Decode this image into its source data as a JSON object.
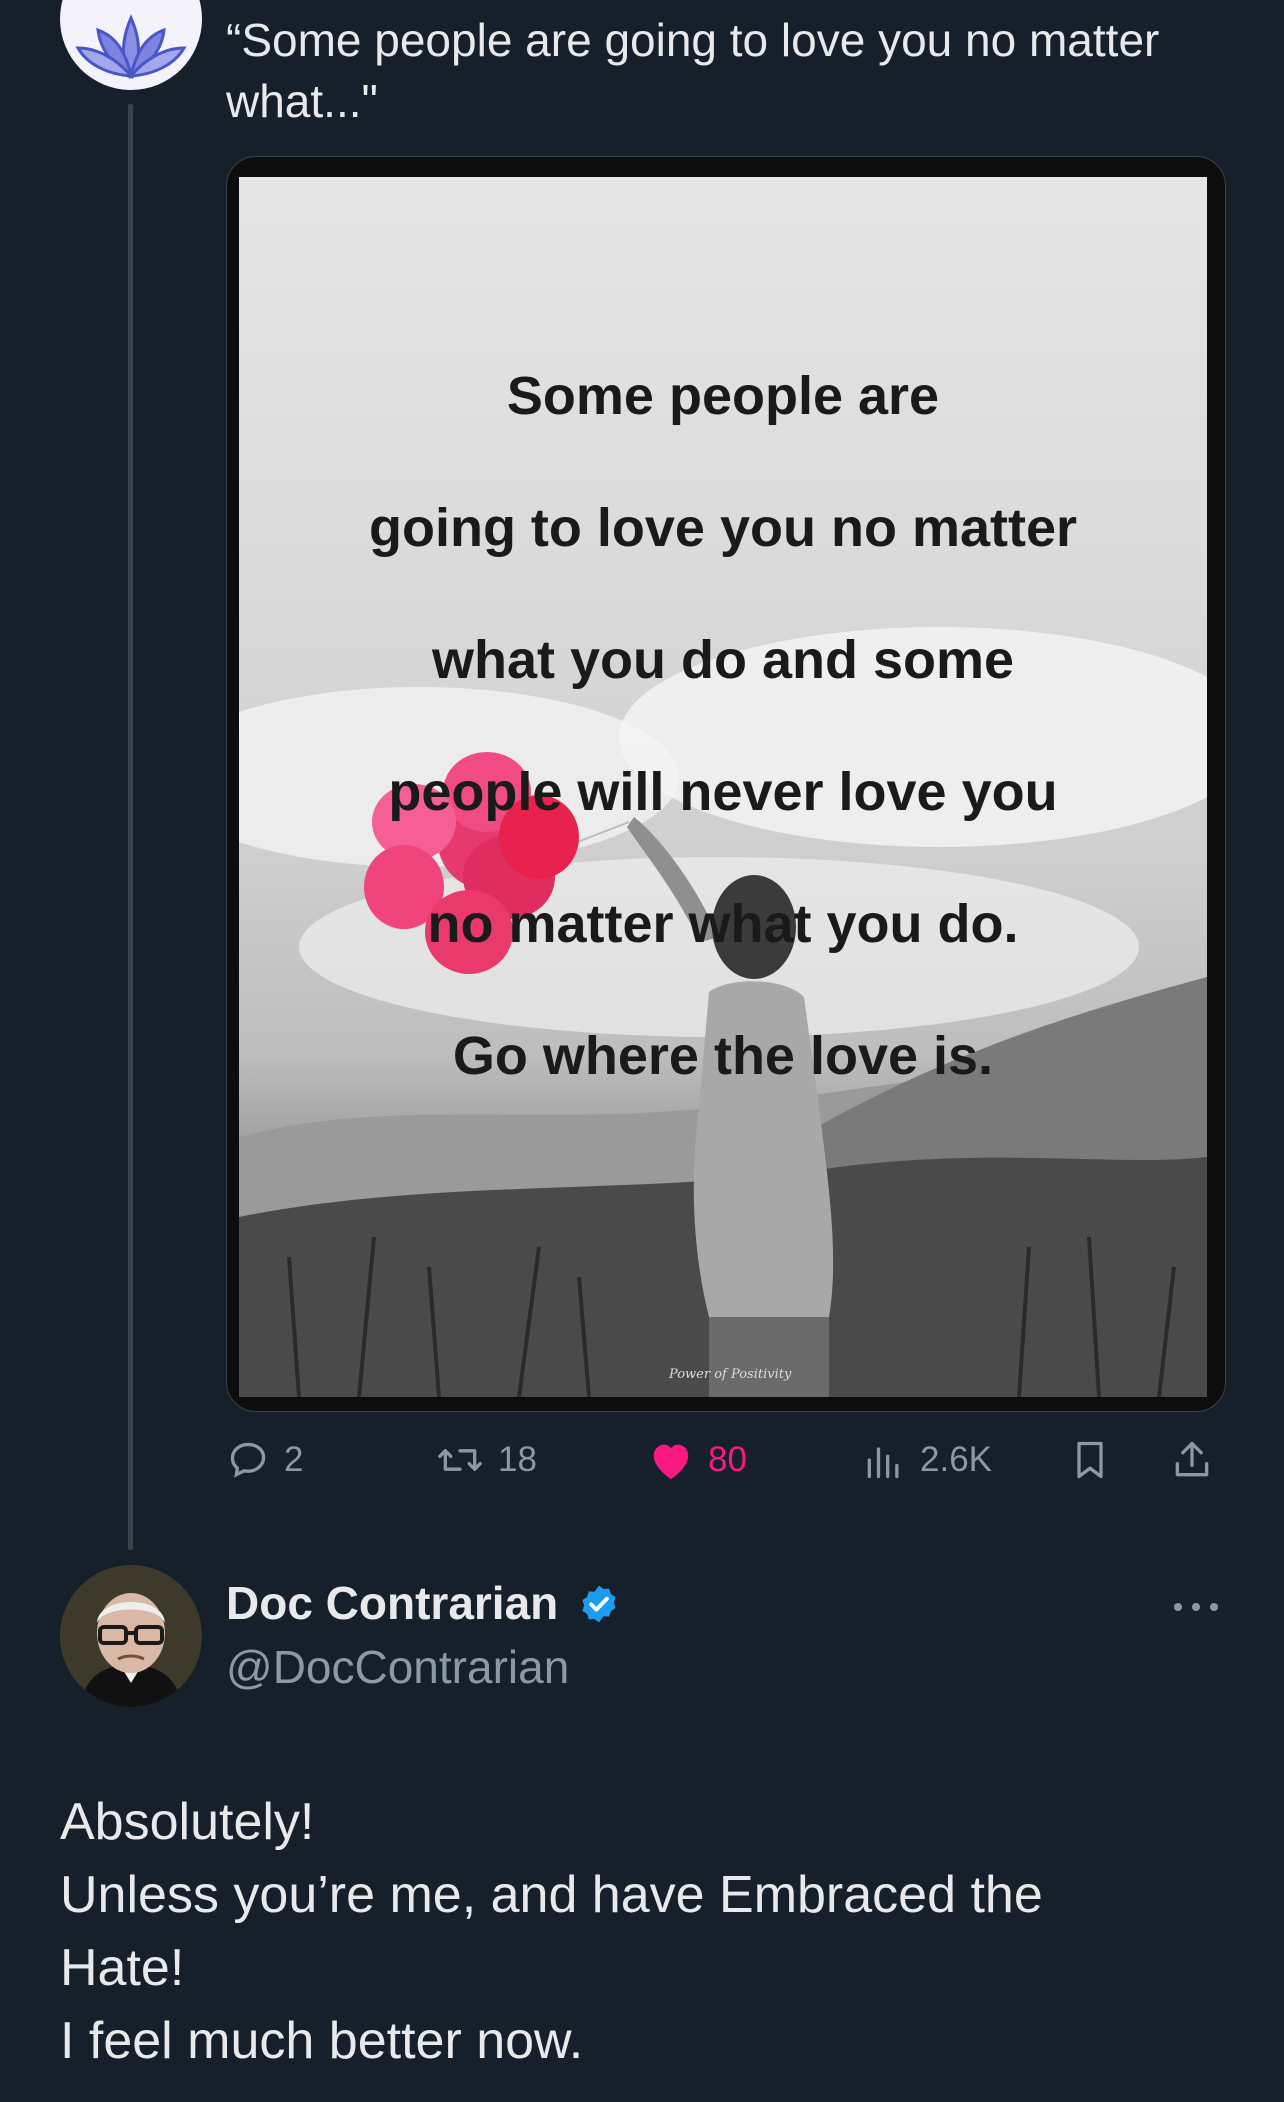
{
  "original_tweet": {
    "text": "“Some people are going to love you no matter what...\"",
    "media": {
      "quote_lines": [
        "Some people are",
        "going to love you no matter",
        "what you do and some",
        "people will never love you",
        "no matter what you do.",
        "Go where the love is."
      ],
      "watermark": "Power of Positivity"
    },
    "actions": {
      "replies": "2",
      "retweets": "18",
      "likes": "80",
      "views": "2.6K"
    }
  },
  "reply": {
    "author_name": "Doc Contrarian",
    "author_handle": "@DocContrarian",
    "verified": true,
    "lines": [
      "Absolutely!",
      "Unless you’re me, and have Embraced the",
      "Hate!",
      "I feel much better now."
    ]
  },
  "colors": {
    "background": "#15202b",
    "text": "#e7e9ea",
    "muted": "#8b98a5",
    "like": "#f91880",
    "verified": "#1d9bf0"
  }
}
